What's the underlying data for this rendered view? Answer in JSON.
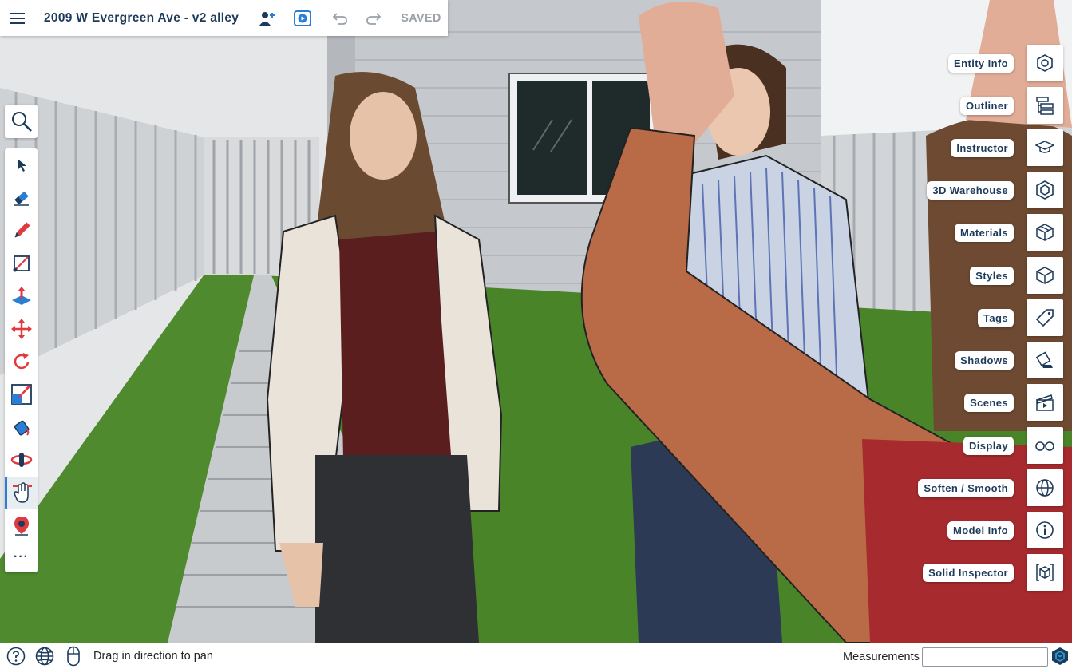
{
  "app": {
    "document_title": "2009 W Evergreen Ave - v2 alley",
    "save_state": "SAVED",
    "accent_color": "#2a7fd4",
    "icon_color": "#1c3a5a"
  },
  "topbar": {
    "menu_icon": "hamburger-icon",
    "share_icon": "add-user-icon",
    "play_icon": "play-icon",
    "undo_icon": "undo-icon",
    "redo_icon": "redo-icon"
  },
  "left_toolbar": {
    "search_icon": "search-icon",
    "tools": [
      {
        "name": "select",
        "icon": "arrow-icon"
      },
      {
        "name": "eraser",
        "icon": "eraser-icon"
      },
      {
        "name": "pencil",
        "icon": "pencil-icon"
      },
      {
        "name": "rectangle",
        "icon": "rectangle-icon"
      },
      {
        "name": "push-pull",
        "icon": "push-pull-icon"
      },
      {
        "name": "move",
        "icon": "move-icon"
      },
      {
        "name": "rotate",
        "icon": "rotate-icon"
      },
      {
        "name": "scale",
        "icon": "scale-icon"
      },
      {
        "name": "paint-bucket",
        "icon": "paint-bucket-icon"
      },
      {
        "name": "orbit",
        "icon": "orbit-icon"
      },
      {
        "name": "pan",
        "icon": "pan-icon",
        "active": true
      },
      {
        "name": "position-camera",
        "icon": "position-camera-icon"
      }
    ],
    "more_label": "···"
  },
  "right_panel": {
    "items": [
      {
        "label": "Entity Info",
        "icon": "entity-info-icon"
      },
      {
        "label": "Outliner",
        "icon": "outliner-icon"
      },
      {
        "label": "Instructor",
        "icon": "graduation-cap-icon"
      },
      {
        "label": "3D Warehouse",
        "icon": "warehouse-icon"
      },
      {
        "label": "Materials",
        "icon": "materials-icon"
      },
      {
        "label": "Styles",
        "icon": "styles-icon"
      },
      {
        "label": "Tags",
        "icon": "tag-icon"
      },
      {
        "label": "Shadows",
        "icon": "shadows-icon"
      },
      {
        "label": "Scenes",
        "icon": "clapperboard-icon"
      },
      {
        "label": "Display",
        "icon": "glasses-icon"
      },
      {
        "label": "Soften / Smooth",
        "icon": "soften-smooth-icon"
      },
      {
        "label": "Model Info",
        "icon": "info-icon"
      },
      {
        "label": "Solid Inspector",
        "icon": "solid-inspector-icon"
      }
    ]
  },
  "statusbar": {
    "help_icon": "help-icon",
    "globe_icon": "globe-icon",
    "mouse_icon": "mouse-icon",
    "status_text": "Drag in direction to pan",
    "measurements_label": "Measurements",
    "measurements_value": "",
    "logo_icon": "sketchup-logo-icon"
  }
}
